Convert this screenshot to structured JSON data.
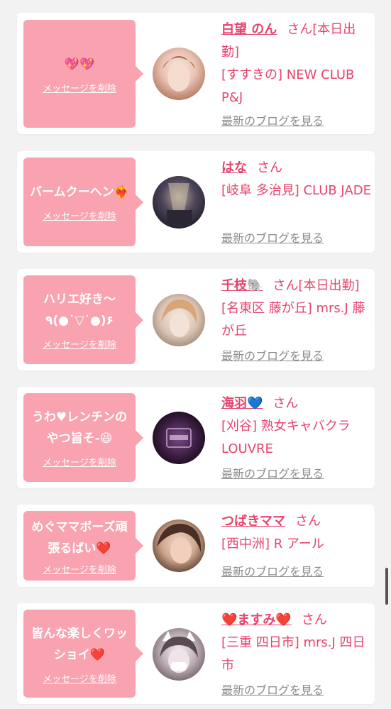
{
  "cards": [
    {
      "message": "💖💖",
      "delete_label": "メッセージを削除",
      "name": "白望 のん",
      "suffix": "さん[本日出勤]",
      "shop": "[すすきの] NEW CLUB P&J",
      "blog_label": "最新のブログを見る",
      "avatar_colors": [
        "#f7e9e3",
        "#c98f76",
        "#f3d1c4"
      ]
    },
    {
      "message": "バームクーヘン❤️‍🔥",
      "delete_label": "メッセージを削除",
      "name": "はな",
      "suffix": "さん",
      "shop": "[岐阜 多治見] CLUB JADE",
      "blog_label": "最新のブログを見る",
      "avatar_colors": [
        "#2d2a38",
        "#8e7f70",
        "#514a5b"
      ]
    },
    {
      "message": "ハリエ好き〜\n٩(●˙▽˙●)۶",
      "delete_label": "メッセージを削除",
      "name": "千枝🐘",
      "suffix": "さん[本日出勤]",
      "shop": "[名東区 藤が丘] mrs.J 藤が丘",
      "blog_label": "最新のブログを見る",
      "avatar_colors": [
        "#e6d6cc",
        "#c5a78c",
        "#f2e8e2"
      ]
    },
    {
      "message": "うわ♥レンチンの\nやつ旨そ-😆",
      "delete_label": "メッセージを削除",
      "name": "海羽💙",
      "suffix": "さん",
      "shop": "[刈谷] 熟女キャバクラ LOUVRE",
      "blog_label": "最新のブログを見る",
      "avatar_colors": [
        "#1d0f1f",
        "#6e3a77",
        "#2f1a33"
      ]
    },
    {
      "message": "めぐママボーズ頑\n張るばい❤️",
      "delete_label": "メッセージを削除",
      "name": "つばきママ",
      "suffix": "さん",
      "shop": "[西中洲] R アール",
      "blog_label": "最新のブログを見る",
      "avatar_colors": [
        "#d9b8a2",
        "#6b4a3a",
        "#f0d6c3"
      ]
    },
    {
      "message": "皆んな楽しくワッ\nショイ❤️",
      "delete_label": "メッセージを削除",
      "name": "❤️ますみ❤️",
      "suffix": "さん",
      "shop": "[三重 四日市] mrs.J 四日市",
      "blog_label": "最新のブログを見る",
      "avatar_colors": [
        "#d8d0d4",
        "#8b7d86",
        "#f4eef1"
      ]
    }
  ]
}
